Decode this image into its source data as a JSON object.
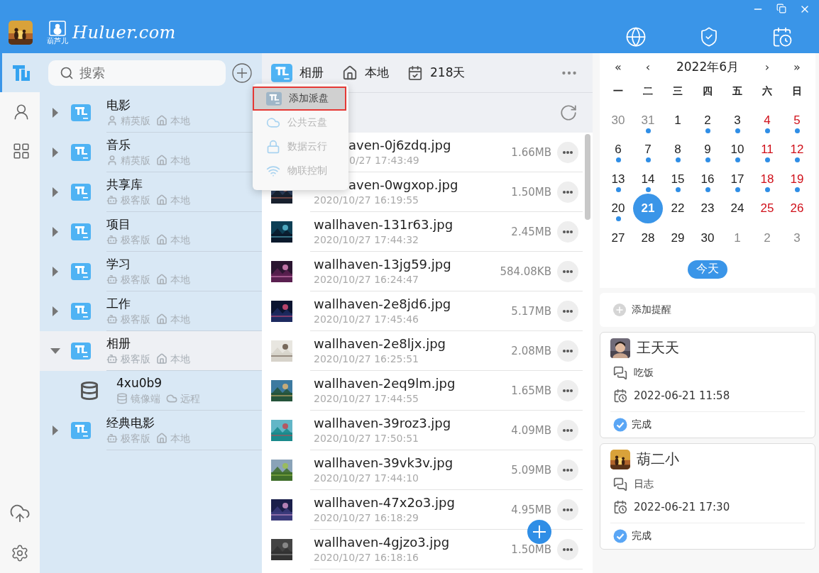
{
  "window": {
    "brand": {
      "caption": "葫芦儿",
      "name": "Huluer.com"
    }
  },
  "rail": {
    "items": [
      {
        "selected": true
      },
      {
        "selected": false
      },
      {
        "selected": false
      }
    ]
  },
  "sidebar": {
    "search": {
      "placeholder": "搜索"
    },
    "items": [
      {
        "title": "电影",
        "kind": "elite",
        "edition": "精英版",
        "location": "本地",
        "expanded": false,
        "selected": false
      },
      {
        "title": "音乐",
        "kind": "elite",
        "edition": "精英版",
        "location": "本地",
        "expanded": false,
        "selected": false
      },
      {
        "title": "共享库",
        "kind": "geek",
        "edition": "极客版",
        "location": "本地",
        "expanded": false,
        "selected": false
      },
      {
        "title": "项目",
        "kind": "geek",
        "edition": "极客版",
        "location": "本地",
        "expanded": false,
        "selected": false
      },
      {
        "title": "学习",
        "kind": "geek",
        "edition": "极客版",
        "location": "本地",
        "expanded": false,
        "selected": false
      },
      {
        "title": "工作",
        "kind": "geek",
        "edition": "极客版",
        "location": "本地",
        "expanded": false,
        "selected": false
      },
      {
        "title": "相册",
        "kind": "geek",
        "edition": "极客版",
        "location": "本地",
        "expanded": true,
        "selected": true,
        "children": [
          {
            "title": "4xu0b9",
            "kind": "mirror",
            "edition": "镜像端",
            "location": "远程",
            "selected": false
          }
        ]
      },
      {
        "title": "经典电影",
        "kind": "geek",
        "edition": "极客版",
        "location": "本地",
        "expanded": false,
        "selected": false
      }
    ]
  },
  "menu": {
    "items": [
      {
        "label": "添加派盘",
        "selected": true,
        "disabled": false
      },
      {
        "label": "公共云盘",
        "selected": false,
        "disabled": true
      },
      {
        "label": "数据云行",
        "selected": false,
        "disabled": true
      },
      {
        "label": "物联控制",
        "selected": false,
        "disabled": true
      }
    ]
  },
  "library": {
    "header": {
      "drive": "相册",
      "location": "本地",
      "days": "218天"
    },
    "files": [
      {
        "name": "aven-0j6zdq.jpg",
        "date": "0/27 17:43:49",
        "size": "1.66MB",
        "thumbnail": false,
        "name_cut": true,
        "date_cut": true
      },
      {
        "name": "aven-0wgxop.jpg",
        "date": "2020/10/27 16:19:55",
        "size": "1.50MB",
        "thumbnail": true,
        "name_cut": true,
        "date_cut": false
      },
      {
        "name": "wallhaven-131r63.jpg",
        "date": "2020/10/27 17:44:32",
        "size": "2.45MB",
        "thumbnail": true,
        "name_cut": false,
        "date_cut": false
      },
      {
        "name": "wallhaven-13jg59.jpg",
        "date": "2020/10/27 16:24:47",
        "size": "584.08KB",
        "thumbnail": true,
        "name_cut": false,
        "date_cut": false
      },
      {
        "name": "wallhaven-2e8jd6.jpg",
        "date": "2020/10/27 17:45:46",
        "size": "5.17MB",
        "thumbnail": true,
        "name_cut": false,
        "date_cut": false
      },
      {
        "name": "wallhaven-2e8ljx.jpg",
        "date": "2020/10/27 16:25:51",
        "size": "2.08MB",
        "thumbnail": true,
        "name_cut": false,
        "date_cut": false
      },
      {
        "name": "wallhaven-2eq9lm.jpg",
        "date": "2020/10/27 17:44:55",
        "size": "1.65MB",
        "thumbnail": true,
        "name_cut": false,
        "date_cut": false
      },
      {
        "name": "wallhaven-39roz3.jpg",
        "date": "2020/10/27 17:50:51",
        "size": "4.09MB",
        "thumbnail": true,
        "name_cut": false,
        "date_cut": false
      },
      {
        "name": "wallhaven-39vk3v.jpg",
        "date": "2020/10/27 17:44:10",
        "size": "5.09MB",
        "thumbnail": true,
        "name_cut": false,
        "date_cut": false
      },
      {
        "name": "wallhaven-47x2o3.jpg",
        "date": "2020/10/27 16:18:29",
        "size": "4.95MB",
        "thumbnail": true,
        "name_cut": false,
        "date_cut": false
      },
      {
        "name": "wallhaven-4gjzo3.jpg",
        "date": "2020/10/27 16:18:16",
        "size": "1.50MB",
        "thumbnail": true,
        "name_cut": false,
        "date_cut": false
      }
    ]
  },
  "calendar": {
    "nav": [
      "«",
      "‹",
      "›",
      "»"
    ],
    "title": "2022年6月",
    "weekdays": [
      "一",
      "二",
      "三",
      "四",
      "五",
      "六",
      "日"
    ],
    "days": [
      {
        "day": "30",
        "kind": "other",
        "dot": false,
        "selected": false
      },
      {
        "day": "31",
        "kind": "other",
        "dot": true,
        "selected": false
      },
      {
        "day": "1",
        "kind": "weekday",
        "dot": false,
        "selected": false
      },
      {
        "day": "2",
        "kind": "weekday",
        "dot": true,
        "selected": false
      },
      {
        "day": "3",
        "kind": "weekday",
        "dot": true,
        "selected": false
      },
      {
        "day": "4",
        "kind": "weekend",
        "dot": true,
        "selected": false
      },
      {
        "day": "5",
        "kind": "weekend",
        "dot": true,
        "selected": false
      },
      {
        "day": "6",
        "kind": "weekday",
        "dot": true,
        "selected": false
      },
      {
        "day": "7",
        "kind": "weekday",
        "dot": true,
        "selected": false
      },
      {
        "day": "8",
        "kind": "weekday",
        "dot": true,
        "selected": false
      },
      {
        "day": "9",
        "kind": "weekday",
        "dot": true,
        "selected": false
      },
      {
        "day": "10",
        "kind": "weekday",
        "dot": true,
        "selected": false
      },
      {
        "day": "11",
        "kind": "weekend",
        "dot": true,
        "selected": false
      },
      {
        "day": "12",
        "kind": "weekend",
        "dot": true,
        "selected": false
      },
      {
        "day": "13",
        "kind": "weekday",
        "dot": true,
        "selected": false
      },
      {
        "day": "14",
        "kind": "weekday",
        "dot": true,
        "selected": false
      },
      {
        "day": "15",
        "kind": "weekday",
        "dot": true,
        "selected": false
      },
      {
        "day": "16",
        "kind": "weekday",
        "dot": true,
        "selected": false
      },
      {
        "day": "17",
        "kind": "weekday",
        "dot": true,
        "selected": false
      },
      {
        "day": "18",
        "kind": "weekend",
        "dot": true,
        "selected": false
      },
      {
        "day": "19",
        "kind": "weekend",
        "dot": true,
        "selected": false
      },
      {
        "day": "20",
        "kind": "weekday",
        "dot": true,
        "selected": false
      },
      {
        "day": "21",
        "kind": "weekday",
        "dot": false,
        "selected": true
      },
      {
        "day": "22",
        "kind": "weekday",
        "dot": false,
        "selected": false
      },
      {
        "day": "23",
        "kind": "weekday",
        "dot": false,
        "selected": false
      },
      {
        "day": "24",
        "kind": "weekday",
        "dot": false,
        "selected": false
      },
      {
        "day": "25",
        "kind": "weekend",
        "dot": false,
        "selected": false
      },
      {
        "day": "26",
        "kind": "weekend",
        "dot": false,
        "selected": false
      },
      {
        "day": "27",
        "kind": "weekday",
        "dot": false,
        "selected": false
      },
      {
        "day": "28",
        "kind": "weekday",
        "dot": false,
        "selected": false
      },
      {
        "day": "29",
        "kind": "weekday",
        "dot": false,
        "selected": false
      },
      {
        "day": "30",
        "kind": "weekday",
        "dot": false,
        "selected": false
      },
      {
        "day": "1",
        "kind": "other",
        "dot": false,
        "selected": false
      },
      {
        "day": "2",
        "kind": "other",
        "dot": false,
        "selected": false
      },
      {
        "day": "3",
        "kind": "other",
        "dot": false,
        "selected": false
      }
    ],
    "today_button": "今天"
  },
  "reminders": {
    "add_label": "添加提醒",
    "items": [
      {
        "name": "王天天",
        "note": "吃饭",
        "time": "2022-06-21 11:58",
        "status": "完成",
        "done": true
      },
      {
        "name": "葫二小",
        "note": "日志",
        "time": "2022-06-21 17:30",
        "status": "完成",
        "done": true
      }
    ]
  }
}
